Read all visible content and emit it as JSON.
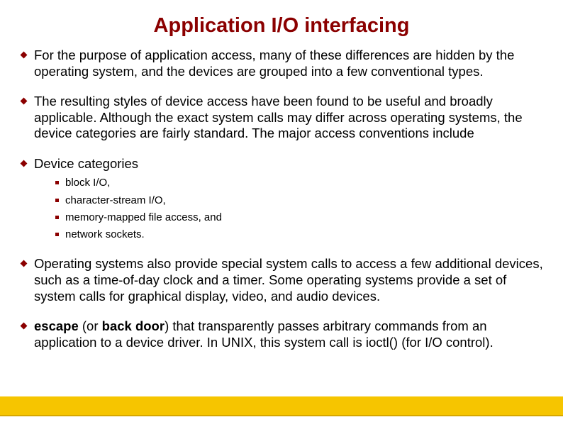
{
  "title": "Application I/O interfacing",
  "bullets": {
    "b1": "For the purpose of application access, many of these differences are hidden by the operating system, and the devices are grouped into a few conventional types.",
    "b2": "The resulting styles of device access have been found to be useful and broadly applicable. Although the exact system calls may differ across operating systems, the device categories are fairly standard. The major access conventions include",
    "b3": "Device categories",
    "b3_sub": [
      "block I/O,",
      "character-stream I/O,",
      "memory-mapped file access, and",
      "network sockets."
    ],
    "b4": "Operating systems also provide special system calls to access a few additional devices, such as a time-of-day clock and a timer. Some operating systems provide a set of system calls for graphical display, video, and audio devices.",
    "b5_bold1": "escape",
    "b5_mid1": " (or ",
    "b5_bold2": "back door",
    "b5_rest": ") that transparently passes arbitrary commands from an application to a device driver. In UNIX, this system call is ioctl()  (for I/O control)."
  }
}
